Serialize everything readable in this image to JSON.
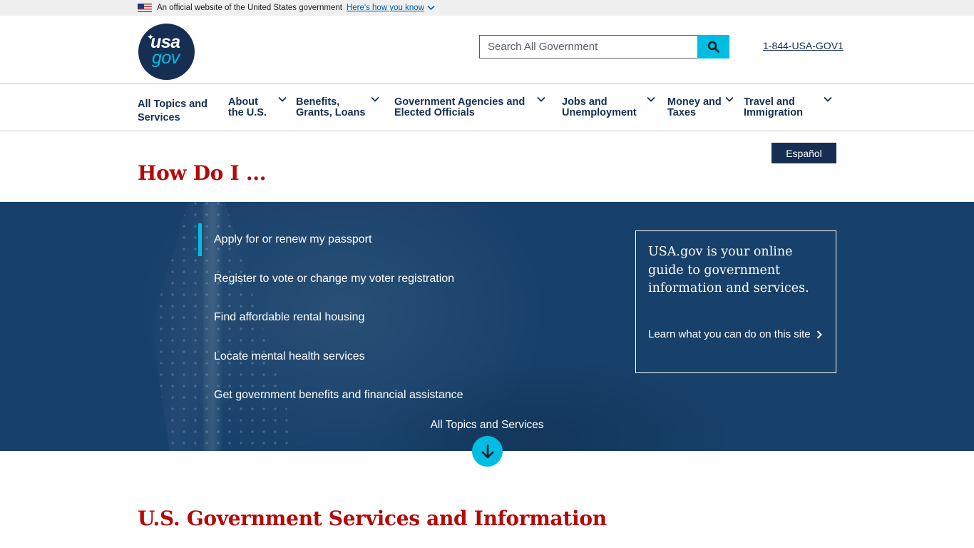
{
  "banner": {
    "text": "An official website of the United States government",
    "link": "Here's how you know"
  },
  "header": {
    "logo_top": "usa",
    "logo_bottom": "gov",
    "search_placeholder": "Search All Government",
    "phone": "1-844-USA-GOV1"
  },
  "nav": {
    "items": [
      {
        "label": "All Topics and Services",
        "has_dropdown": false
      },
      {
        "label": "About the U.S.",
        "has_dropdown": true
      },
      {
        "label": "Benefits, Grants, Loans",
        "has_dropdown": true
      },
      {
        "label": "Government Agencies and Elected Officials",
        "has_dropdown": true
      },
      {
        "label": "Jobs and Unemployment",
        "has_dropdown": true
      },
      {
        "label": "Money and Taxes",
        "has_dropdown": true
      },
      {
        "label": "Travel and Immigration",
        "has_dropdown": true
      }
    ]
  },
  "page": {
    "language_button": "Español",
    "how_do_i": "How Do I ..."
  },
  "hero": {
    "tasks": [
      {
        "label": "Apply for or renew my passport",
        "active": true
      },
      {
        "label": "Register to vote or change my voter registration",
        "active": false
      },
      {
        "label": "Find affordable rental housing",
        "active": false
      },
      {
        "label": "Locate mental health services",
        "active": false
      },
      {
        "label": "Get government benefits and financial assistance",
        "active": false
      }
    ],
    "guide_text": "USA.gov is your online guide to government information and services.",
    "learn_link": "Learn what you can do on this site",
    "all_topics": "All Topics and Services"
  },
  "section_title": "U.S. Government Services and Information",
  "colors": {
    "navy": "#162e51",
    "cyan": "#00bde3",
    "red": "#b50909",
    "hero_bg": "#17406a"
  }
}
